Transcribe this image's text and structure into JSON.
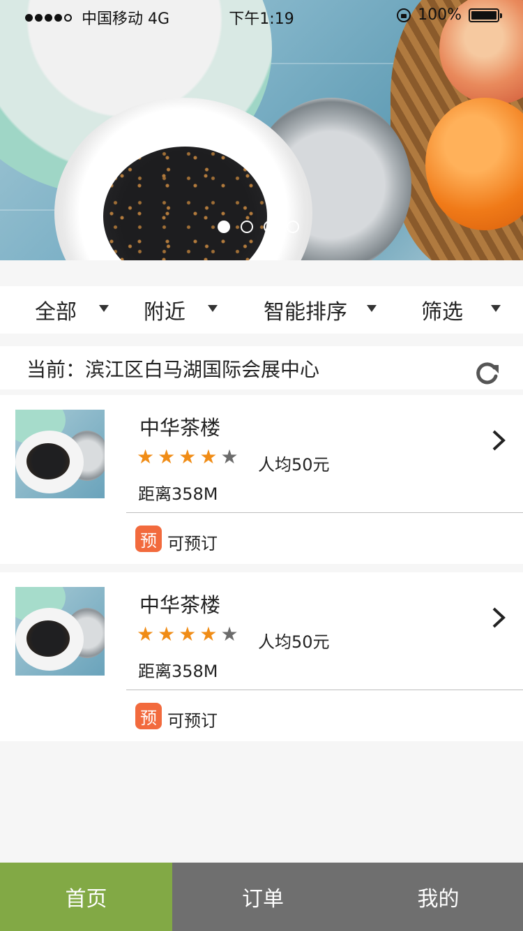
{
  "status_bar": {
    "carrier": "中国移动 4G",
    "time": "下午1:19",
    "battery": "100%"
  },
  "banner": {
    "pages": 4,
    "active_page": 1
  },
  "filters": [
    {
      "label": "全部"
    },
    {
      "label": "附近"
    },
    {
      "label": "智能排序"
    },
    {
      "label": "筛选"
    }
  ],
  "location": {
    "text": "当前：滨江区白马湖国际会展中心"
  },
  "shops": [
    {
      "name": "中华茶楼",
      "rating": 4,
      "max_rating": 5,
      "price": "人均50元",
      "distance": "距离358M",
      "badge": "预",
      "reserve_text": "可预订"
    },
    {
      "name": "中华茶楼",
      "rating": 4,
      "max_rating": 5,
      "price": "人均50元",
      "distance": "距离358M",
      "badge": "预",
      "reserve_text": "可预订"
    }
  ],
  "tabbar": [
    {
      "label": "首页",
      "active": true
    },
    {
      "label": "订单",
      "active": false
    },
    {
      "label": "我的",
      "active": false
    }
  ],
  "colors": {
    "tab_active": "#82a945",
    "tab_inactive": "#6f6f6f",
    "star_on": "#f08c16",
    "star_off": "#6b6b6b",
    "badge": "#f26a3d"
  }
}
